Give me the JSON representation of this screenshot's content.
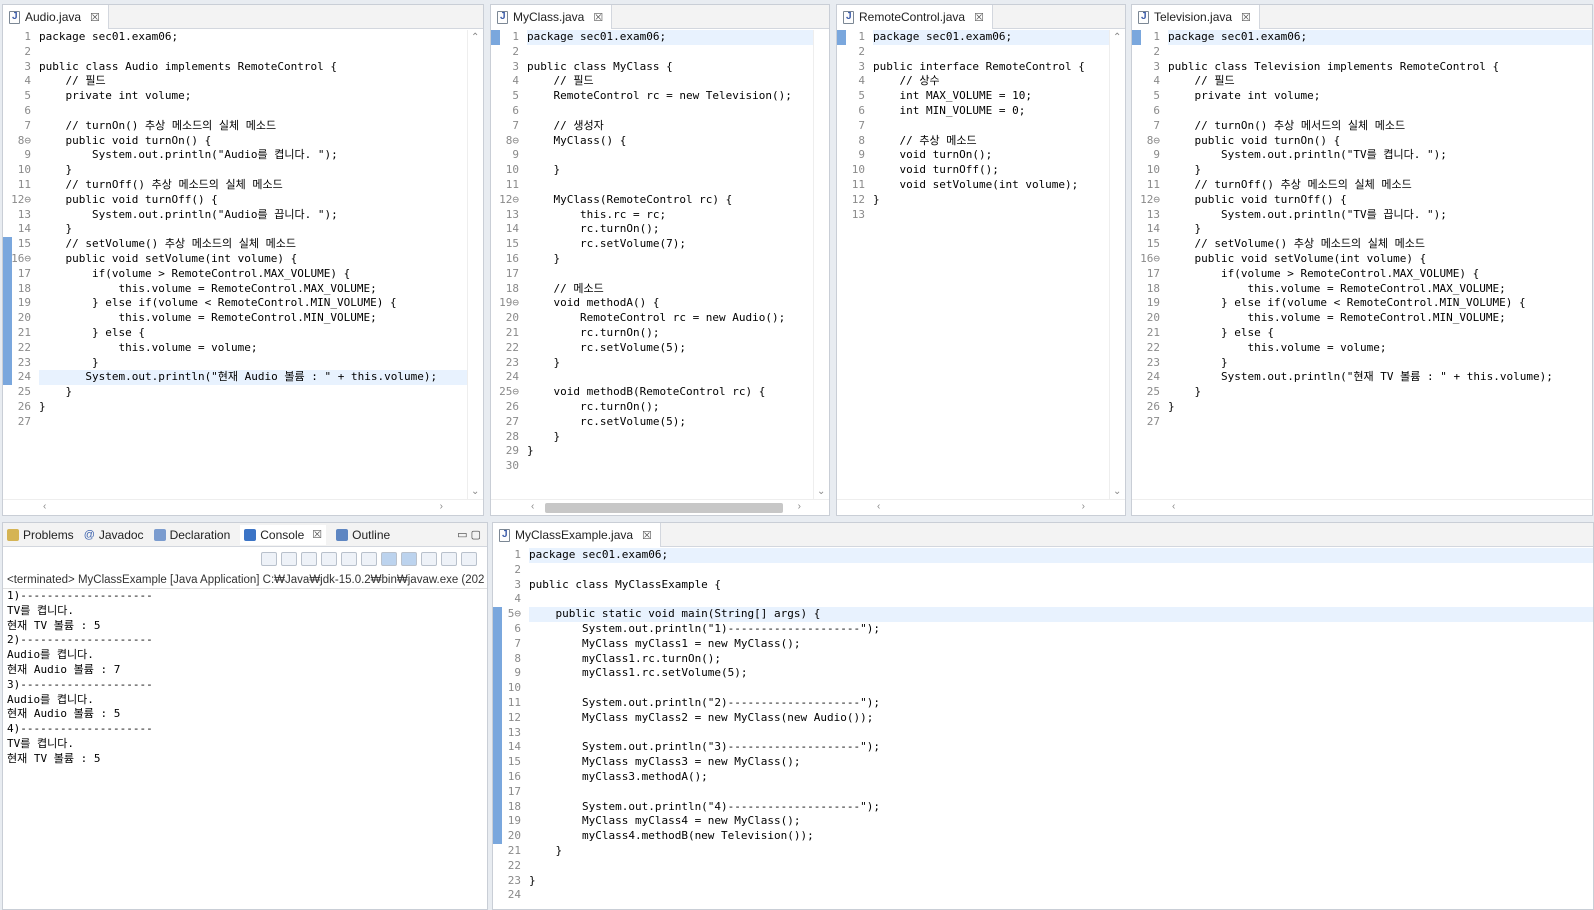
{
  "editors": {
    "audio": {
      "tab": "Audio.java",
      "lines": [
        "package sec01.exam06;",
        "",
        "public class Audio implements RemoteControl {",
        "    // 필드",
        "    private int volume;",
        "",
        "    // turnOn() 추상 메소드의 실체 메소드",
        "    public void turnOn() {",
        "        System.out.println(\"Audio를 켭니다. \");",
        "    }",
        "    // turnOff() 추상 메소드의 실체 메소드",
        "    public void turnOff() {",
        "        System.out.println(\"Audio를 끕니다. \");",
        "    }",
        "    // setVolume() 추상 메소드의 실체 메소드",
        "    public void setVolume(int volume) {",
        "        if(volume > RemoteControl.MAX_VOLUME) {",
        "            this.volume = RemoteControl.MAX_VOLUME;",
        "        } else if(volume < RemoteControl.MIN_VOLUME) {",
        "            this.volume = RemoteControl.MIN_VOLUME;",
        "        } else {",
        "            this.volume = volume;",
        "        }",
        "       System.out.println(\"현재 Audio 볼륨 : \" + this.volume);",
        "    }",
        "}",
        ""
      ],
      "nums": [
        "1",
        "2",
        "3",
        "4",
        "5",
        "6",
        "7",
        "8⊖",
        "9",
        "10",
        "11",
        "12⊖",
        "13",
        "14",
        "15",
        "16⊖",
        "17",
        "18",
        "19",
        "20",
        "21",
        "22",
        "23",
        "24",
        "25",
        "26",
        "27"
      ]
    },
    "myclass": {
      "tab": "MyClass.java",
      "lines": [
        "package sec01.exam06;",
        "",
        "public class MyClass {",
        "    // 필드",
        "    RemoteControl rc = new Television();",
        "",
        "    // 생성자",
        "    MyClass() {",
        "",
        "    }",
        "",
        "    MyClass(RemoteControl rc) {",
        "        this.rc = rc;",
        "        rc.turnOn();",
        "        rc.setVolume(7);",
        "    }",
        "",
        "    // 메소드",
        "    void methodA() {",
        "        RemoteControl rc = new Audio();",
        "        rc.turnOn();",
        "        rc.setVolume(5);",
        "    }",
        "",
        "    void methodB(RemoteControl rc) {",
        "        rc.turnOn();",
        "        rc.setVolume(5);",
        "    }",
        "}",
        ""
      ],
      "nums": [
        "1",
        "2",
        "3",
        "4",
        "5",
        "6",
        "7",
        "8⊖",
        "9",
        "10",
        "11",
        "12⊖",
        "13",
        "14",
        "15",
        "16",
        "17",
        "18",
        "19⊖",
        "20",
        "21",
        "22",
        "23",
        "24",
        "25⊖",
        "26",
        "27",
        "28",
        "29",
        "30"
      ]
    },
    "remote": {
      "tab": "RemoteControl.java",
      "lines": [
        "package sec01.exam06;",
        "",
        "public interface RemoteControl {",
        "    // 상수",
        "    int MAX_VOLUME = 10;",
        "    int MIN_VOLUME = 0;",
        "",
        "    // 추상 메소드",
        "    void turnOn();",
        "    void turnOff();",
        "    void setVolume(int volume);",
        "}",
        ""
      ],
      "nums": [
        "1",
        "2",
        "3",
        "4",
        "5",
        "6",
        "7",
        "8",
        "9",
        "10",
        "11",
        "12",
        "13"
      ]
    },
    "tv": {
      "tab": "Television.java",
      "lines": [
        "package sec01.exam06;",
        "",
        "public class Television implements RemoteControl {",
        "    // 필드",
        "    private int volume;",
        "",
        "    // turnOn() 추상 메서드의 실체 메소드",
        "    public void turnOn() {",
        "        System.out.println(\"TV를 켭니다. \");",
        "    }",
        "    // turnOff() 추상 메소드의 실체 메소드",
        "    public void turnOff() {",
        "        System.out.println(\"TV를 끕니다. \");",
        "    }",
        "    // setVolume() 추상 메소드의 실체 메소드",
        "    public void setVolume(int volume) {",
        "        if(volume > RemoteControl.MAX_VOLUME) {",
        "            this.volume = RemoteControl.MAX_VOLUME;",
        "        } else if(volume < RemoteControl.MIN_VOLUME) {",
        "            this.volume = RemoteControl.MIN_VOLUME;",
        "        } else {",
        "            this.volume = volume;",
        "        }",
        "        System.out.println(\"현재 TV 볼륨 : \" + this.volume);",
        "    }",
        "}",
        ""
      ],
      "nums": [
        "1",
        "2",
        "3",
        "4",
        "5",
        "6",
        "7",
        "8⊖",
        "9",
        "10",
        "11",
        "12⊖",
        "13",
        "14",
        "15",
        "16⊖",
        "17",
        "18",
        "19",
        "20",
        "21",
        "22",
        "23",
        "24",
        "25",
        "26",
        "27"
      ]
    },
    "example": {
      "tab": "MyClassExample.java",
      "lines": [
        "package sec01.exam06;",
        "",
        "public class MyClassExample {",
        "",
        "    public static void main(String[] args) {",
        "        System.out.println(\"1)--------------------\");",
        "        MyClass myClass1 = new MyClass();",
        "        myClass1.rc.turnOn();",
        "        myClass1.rc.setVolume(5);",
        "",
        "        System.out.println(\"2)--------------------\");",
        "        MyClass myClass2 = new MyClass(new Audio());",
        "",
        "        System.out.println(\"3)--------------------\");",
        "        MyClass myClass3 = new MyClass();",
        "        myClass3.methodA();",
        "",
        "        System.out.println(\"4)--------------------\");",
        "        MyClass myClass4 = new MyClass();",
        "        myClass4.methodB(new Television());",
        "    }",
        "",
        "}",
        ""
      ],
      "nums": [
        "1",
        "2",
        "3",
        "4",
        "5⊖",
        "6",
        "7",
        "8",
        "9",
        "10",
        "11",
        "12",
        "13",
        "14",
        "15",
        "16",
        "17",
        "18",
        "19",
        "20",
        "21",
        "22",
        "23",
        "24"
      ]
    }
  },
  "views": {
    "tabs": [
      "Problems",
      "Javadoc",
      "Declaration",
      "Console",
      "Outline"
    ],
    "console_header": "<terminated> MyClassExample [Java Application] C:₩Java₩jdk-15.0.2₩bin₩javaw.exe  (202",
    "console_lines": [
      "1)--------------------",
      "TV를 켭니다.",
      "현재 TV 볼륨 : 5",
      "2)--------------------",
      "Audio를 켭니다.",
      "현재 Audio 볼륨 : 7",
      "3)--------------------",
      "Audio를 켭니다.",
      "현재 Audio 볼륨 : 5",
      "4)--------------------",
      "TV를 켭니다.",
      "현재 TV 볼륨 : 5"
    ]
  }
}
